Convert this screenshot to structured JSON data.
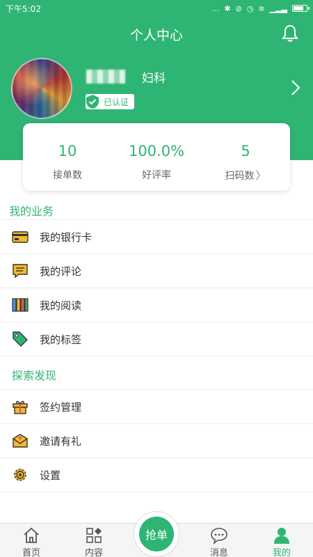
{
  "status_bar": {
    "time": "下午5:02",
    "signal_text": "...",
    "battery_icon": "battery-icon"
  },
  "header": {
    "title": "个人中心",
    "department": "妇科",
    "verified_badge": "已认证",
    "colors": {
      "brand": "#2fb573"
    }
  },
  "stats": [
    {
      "value": "10",
      "label": "接单数"
    },
    {
      "value": "100.0%",
      "label": "好评率"
    },
    {
      "value": "5",
      "label": "扫码数"
    }
  ],
  "business": {
    "title": "我的业务",
    "items": [
      {
        "label": "我的银行卡",
        "icon": "bank-card-icon"
      },
      {
        "label": "我的评论",
        "icon": "comment-icon"
      },
      {
        "label": "我的阅读",
        "icon": "books-icon"
      },
      {
        "label": "我的标签",
        "icon": "tag-icon"
      }
    ]
  },
  "explore": {
    "title": "探索发现",
    "items": [
      {
        "label": "签约管理",
        "icon": "gift-box-icon"
      },
      {
        "label": "邀请有礼",
        "icon": "envelope-icon"
      },
      {
        "label": "设置",
        "icon": "gear-icon"
      }
    ]
  },
  "bottom_nav": {
    "items": [
      {
        "label": "首页",
        "icon": "home-icon"
      },
      {
        "label": "内容",
        "icon": "grid-icon"
      },
      {
        "label": "消息",
        "icon": "chat-icon"
      },
      {
        "label": "我的",
        "icon": "person-icon",
        "active": true
      }
    ],
    "center_button": "抢单"
  }
}
